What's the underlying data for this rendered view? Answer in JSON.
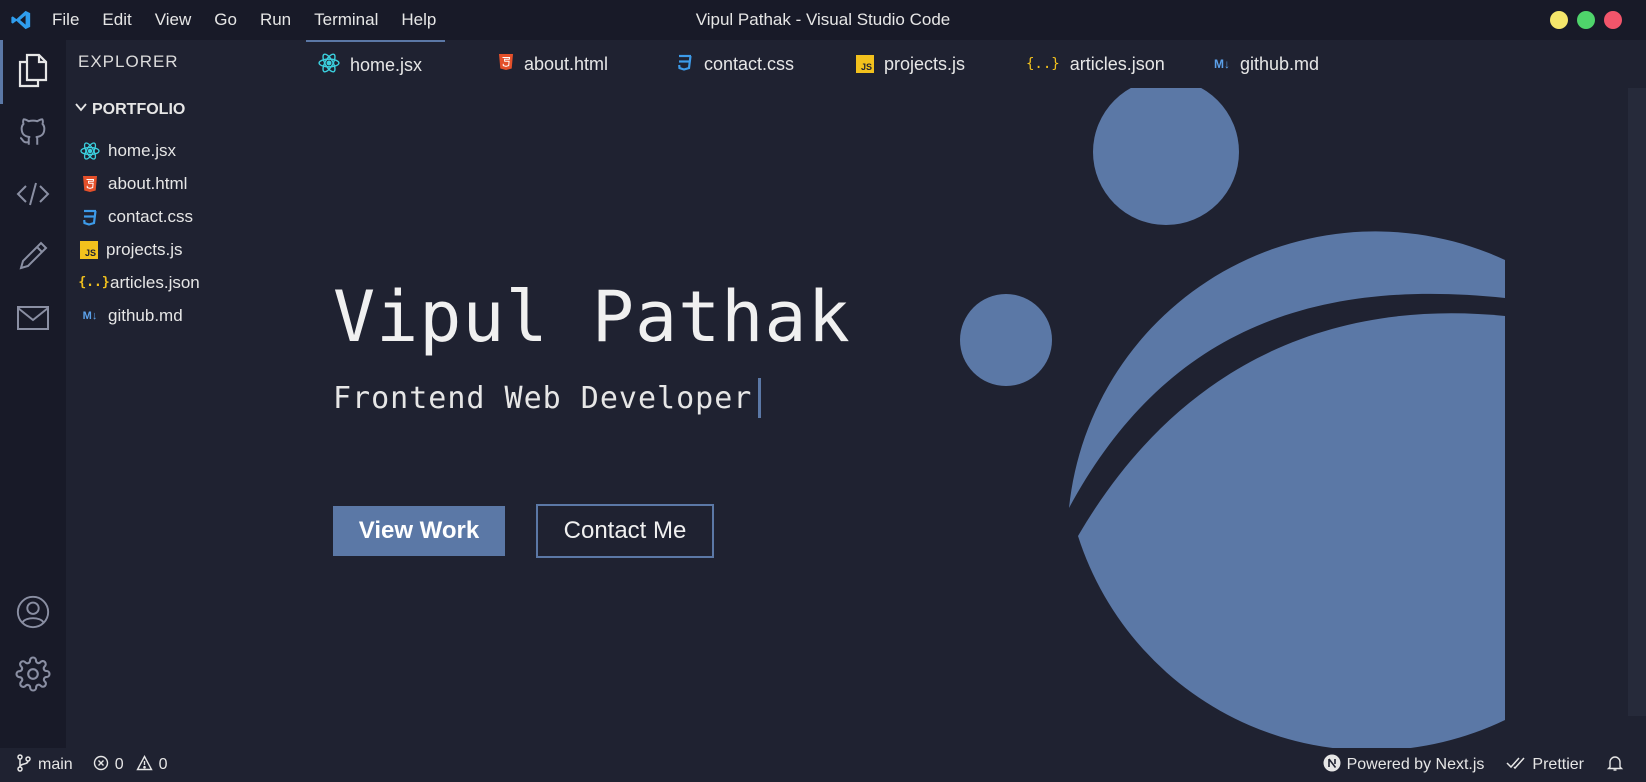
{
  "window": {
    "title": "Vipul Pathak - Visual Studio Code",
    "menu": [
      "File",
      "Edit",
      "View",
      "Go",
      "Run",
      "Terminal",
      "Help"
    ],
    "traffic_colors": [
      "#f5e66b",
      "#4fd46b",
      "#f2556b"
    ]
  },
  "activity": {
    "items": [
      {
        "icon": "files-icon",
        "active": true
      },
      {
        "icon": "github-icon",
        "active": false
      },
      {
        "icon": "code-icon",
        "active": false
      },
      {
        "icon": "pencil-icon",
        "active": false
      },
      {
        "icon": "mail-icon",
        "active": false
      }
    ],
    "bottom": [
      {
        "icon": "account-icon"
      },
      {
        "icon": "gear-icon"
      }
    ]
  },
  "sidebar": {
    "title": "EXPLORER",
    "folder": "PORTFOLIO",
    "files": [
      {
        "name": "home.jsx",
        "icon": "react-icon"
      },
      {
        "name": "about.html",
        "icon": "html-icon"
      },
      {
        "name": "contact.css",
        "icon": "css-icon"
      },
      {
        "name": "projects.js",
        "icon": "js-icon"
      },
      {
        "name": "articles.json",
        "icon": "json-icon"
      },
      {
        "name": "github.md",
        "icon": "markdown-icon"
      }
    ]
  },
  "tabs": [
    {
      "label": "home.jsx",
      "icon": "react-icon",
      "active": true
    },
    {
      "label": "about.html",
      "icon": "html-icon",
      "active": false
    },
    {
      "label": "contact.css",
      "icon": "css-icon",
      "active": false
    },
    {
      "label": "projects.js",
      "icon": "js-icon",
      "active": false
    },
    {
      "label": "articles.json",
      "icon": "json-icon",
      "active": false
    },
    {
      "label": "github.md",
      "icon": "markdown-icon",
      "active": false
    }
  ],
  "hero": {
    "name": "Vipul Pathak",
    "role": "Frontend Web Developer",
    "primary_button": "View Work",
    "secondary_button": "Contact Me",
    "accent_color": "#5b78a6"
  },
  "statusbar": {
    "branch": "main",
    "errors": "0",
    "warnings": "0",
    "powered_by": "Powered by Next.js",
    "formatter": "Prettier"
  }
}
